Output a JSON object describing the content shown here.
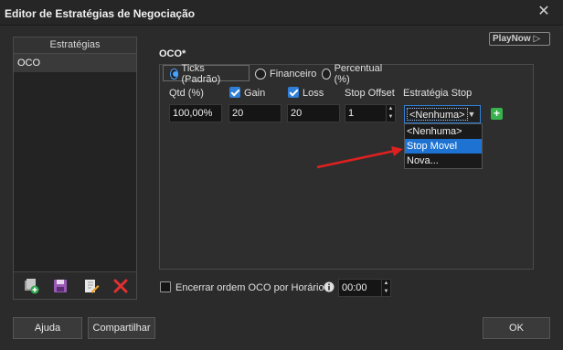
{
  "window": {
    "title": "Editor de Estratégias de Negociação"
  },
  "strategies": {
    "header": "Estratégias",
    "items": [
      "OCO"
    ]
  },
  "playnow": "PlayNow ▷",
  "oco": {
    "title": "OCO*",
    "radios": [
      "Ticks (Padrão)",
      "Financeiro",
      "Percentual (%)"
    ],
    "selected_radio": "Ticks (Padrão)",
    "labels": {
      "qtd": "Qtd (%)",
      "gain": "Gain",
      "loss": "Loss",
      "stop_offset": "Stop Offset",
      "estrategia_stop": "Estratégia Stop"
    },
    "values": {
      "qtd": "100,00%",
      "gain": "20",
      "loss": "20",
      "stop_offset": "1",
      "estrategia_stop": "<Nenhuma>"
    },
    "dropdown_options": [
      "<Nenhuma>",
      "Stop Movel",
      "Nova..."
    ],
    "dropdown_highlighted": "Stop Movel",
    "add_glyph": "+"
  },
  "bottom": {
    "check_label": "Encerrar ordem OCO por Horário",
    "time_value": "00:00"
  },
  "buttons": {
    "help": "Ajuda",
    "share": "Compartilhar",
    "ok": "OK"
  },
  "colors": {
    "accent": "#2f7fd8",
    "highlight": "#1e73d2",
    "add_green": "#37b24d",
    "annotation_arrow": "#e02020"
  }
}
